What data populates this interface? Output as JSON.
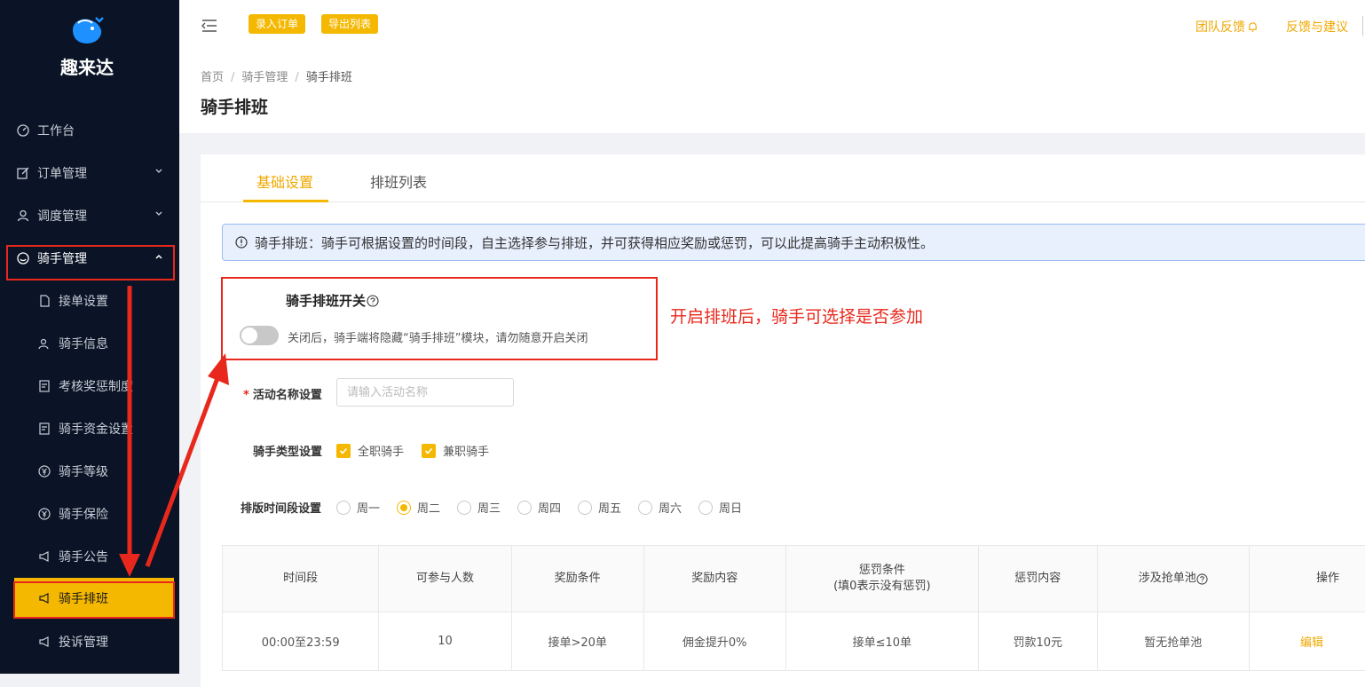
{
  "app": {
    "name": "趣来达"
  },
  "sidebar": {
    "items": [
      {
        "label": "工作台",
        "icon": "dashboard-icon"
      },
      {
        "label": "订单管理",
        "icon": "edit-icon"
      },
      {
        "label": "调度管理",
        "icon": "user-icon"
      },
      {
        "label": "骑手管理",
        "icon": "smile-icon"
      },
      {
        "label": "接单设置",
        "icon": "file-icon"
      },
      {
        "label": "骑手信息",
        "icon": "team-icon"
      },
      {
        "label": "考核奖惩制度",
        "icon": "doc-icon"
      },
      {
        "label": "骑手资金设置",
        "icon": "doc-icon"
      },
      {
        "label": "骑手等级",
        "icon": "yen-icon"
      },
      {
        "label": "骑手保险",
        "icon": "yen-icon"
      },
      {
        "label": "骑手公告",
        "icon": "megaphone-icon"
      },
      {
        "label": "骑手排班",
        "icon": "megaphone-icon"
      },
      {
        "label": "投诉管理",
        "icon": "megaphone-icon"
      }
    ]
  },
  "topbar": {
    "btn_add_order": "录入订单",
    "btn_export": "导出列表",
    "team_feedback": "团队反馈",
    "feedback_suggest": "反馈与建议"
  },
  "breadcrumb": {
    "home": "首页",
    "parent": "骑手管理",
    "current": "骑手排班",
    "sep": "/"
  },
  "page_title": "骑手排班",
  "tabs": {
    "basic": "基础设置",
    "list": "排班列表"
  },
  "notice": "骑手排班：骑手可根据设置的时间段，自主选择参与排班，并可获得相应奖励或惩罚，可以此提高骑手主动积极性。",
  "switch_section": {
    "title": "骑手排班开关",
    "desc": "关闭后，骑手端将隐藏“骑手排班”模块，请勿随意开启关闭",
    "enabled": false
  },
  "annotation": "开启排班后，骑手可选择是否参加",
  "form": {
    "activity_label": "活动名称设置",
    "required_mark": "*",
    "activity_placeholder": "请输入活动名称",
    "rider_type_label": "骑手类型设置",
    "rider_types": [
      {
        "label": "全职骑手",
        "checked": true
      },
      {
        "label": "兼职骑手",
        "checked": true
      }
    ],
    "schedule_label": "排版时间段设置",
    "days": [
      {
        "label": "周一",
        "selected": false
      },
      {
        "label": "周二",
        "selected": true
      },
      {
        "label": "周三",
        "selected": false
      },
      {
        "label": "周四",
        "selected": false
      },
      {
        "label": "周五",
        "selected": false
      },
      {
        "label": "周六",
        "selected": false
      },
      {
        "label": "周日",
        "selected": false
      }
    ]
  },
  "table": {
    "headers": [
      "时间段",
      "可参与人数",
      "奖励条件",
      "奖励内容",
      "惩罚条件",
      "(填0表示没有惩罚)",
      "惩罚内容",
      "涉及抢单池",
      "操作"
    ],
    "rows": [
      [
        "00:00至23:59",
        "10",
        "接单>20单",
        "佣金提升0%",
        "接单≤10单",
        "罚款10元",
        "暂无抢单池",
        "编辑"
      ]
    ]
  },
  "colors": {
    "accent": "#f5b800",
    "sidebar_bg": "#0a1426",
    "annotation_red": "#e8281c"
  }
}
